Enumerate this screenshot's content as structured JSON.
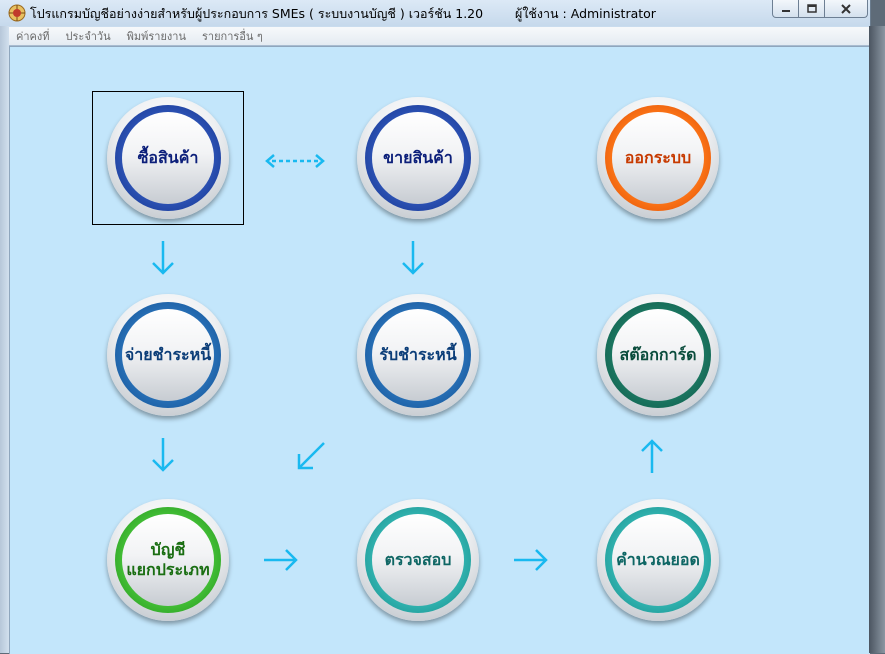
{
  "window": {
    "title": "โปรแกรมบัญชีอย่างง่ายสำหรับผู้ประกอบการ SMEs ( ระบบงานบัญชี )  เวอร์ชัน 1.20",
    "user": "ผู้ใช้งาน : Administrator"
  },
  "menu": {
    "items": [
      "ค่าคงที่",
      "ประจำวัน",
      "พิมพ์รายงาน",
      "รายการอื่น ๆ"
    ]
  },
  "buttons": {
    "buy": "ซื้อสินค้า",
    "sell": "ขายสินค้า",
    "logout": "ออกระบบ",
    "pay_debt": "จ่ายชำระหนี้",
    "receive_debt": "รับชำระหนี้",
    "stock_card": "สต๊อกการ์ด",
    "ledger_line1": "บัญชี",
    "ledger_line2": "แยกประเภท",
    "verify": "ตรวจสอบ",
    "calc_balance": "คำนวณยอด"
  },
  "colors": {
    "client_bg": "#c3e6fb",
    "arrow": "#19b9f0",
    "navy_ring": "#1a3ea3",
    "steel_ring": "#1a5fa8",
    "orange_ring": "#f05a0a",
    "darkgreen_ring": "#146a55",
    "green_ring": "#2fae25",
    "teal_ring": "#20a3a0"
  }
}
